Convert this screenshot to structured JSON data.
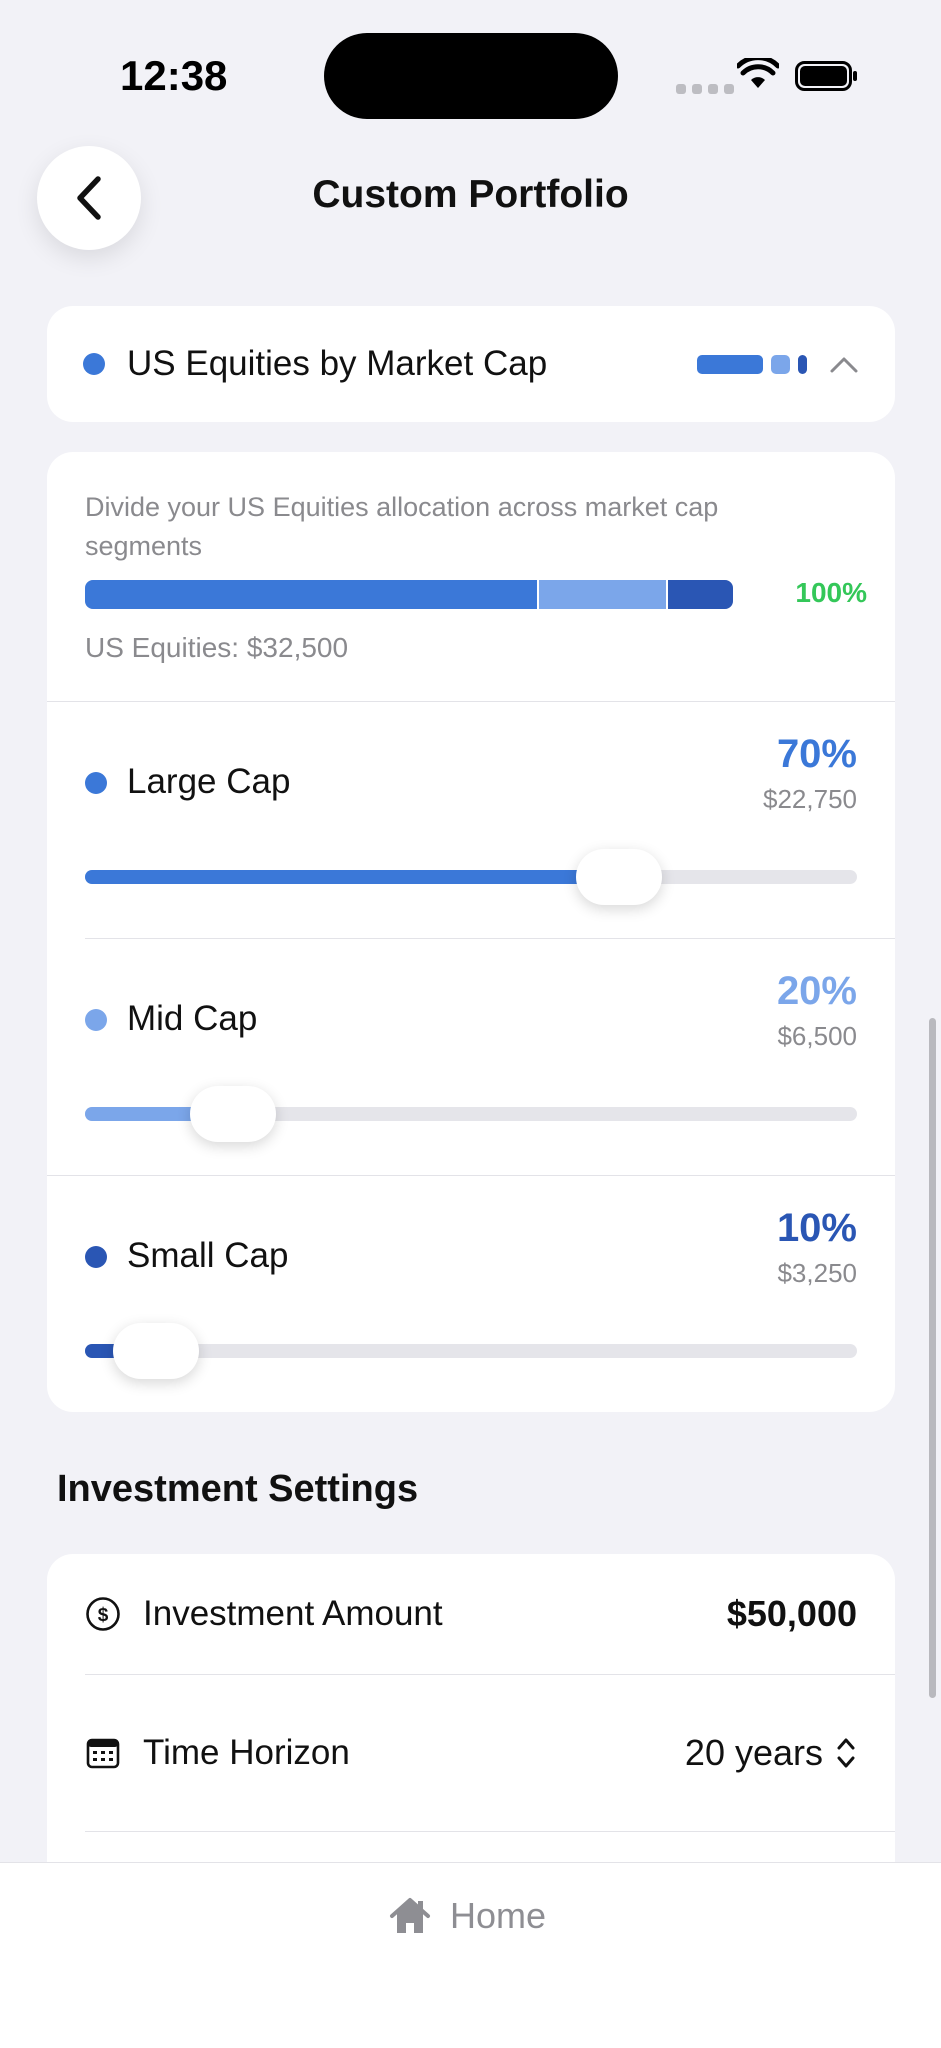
{
  "status_bar": {
    "time": "12:38"
  },
  "nav": {
    "title": "Custom Portfolio",
    "back_icon": "chevron-left-icon"
  },
  "colors": {
    "large": "#3B78D8",
    "mid": "#7BA6EA",
    "small": "#2A56B4",
    "success": "#34C759",
    "track": "#E5E5EA"
  },
  "section": {
    "title": "US Equities by Market Cap",
    "expand_icon": "chevron-up-icon"
  },
  "allocation": {
    "description": "Divide your US Equities allocation across market cap segments",
    "total_percent": "100%",
    "total_label": "US Equities: $32,500",
    "segments": [
      {
        "name": "Large Cap",
        "percent_text": "70%",
        "amount": "$22,750",
        "fraction": 0.7,
        "color": "#3B78D8"
      },
      {
        "name": "Mid Cap",
        "percent_text": "20%",
        "amount": "$6,500",
        "fraction": 0.2,
        "color": "#7BA6EA"
      },
      {
        "name": "Small Cap",
        "percent_text": "10%",
        "amount": "$3,250",
        "fraction": 0.1,
        "color": "#2A56B4"
      }
    ]
  },
  "settings": {
    "heading": "Investment Settings",
    "rows": [
      {
        "icon": "dollar-circle-icon",
        "label": "Investment Amount",
        "value": "$50,000"
      },
      {
        "icon": "calendar-icon",
        "label": "Time Horizon",
        "value": "20 years",
        "value_icon": "up-down-chevron-icon"
      }
    ]
  },
  "tab_bar": {
    "home_label": "Home",
    "home_icon": "home-icon"
  }
}
